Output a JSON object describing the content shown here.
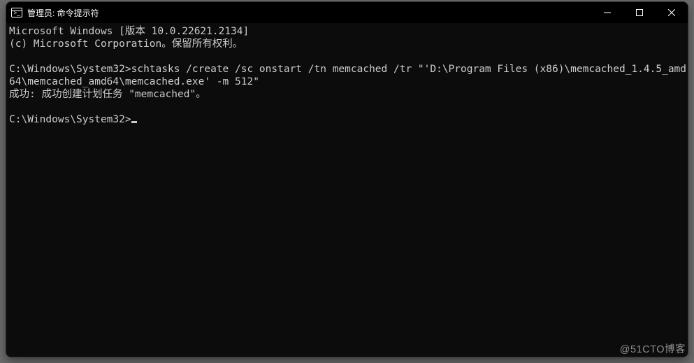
{
  "window": {
    "title": "管理员: 命令提示符"
  },
  "terminal": {
    "banner_line1": "Microsoft Windows [版本 10.0.22621.2134]",
    "banner_line2": "(c) Microsoft Corporation。保留所有权利。",
    "prompt1": "C:\\Windows\\System32>",
    "command": "schtasks /create /sc onstart /tn memcached /tr \"'D:\\Program Files (x86)\\memcached_1.4.5_amd64\\memcached_amd64\\memcached.exe' -m 512\"",
    "result": "成功: 成功创建计划任务 \"memcached\"。",
    "prompt2": "C:\\Windows\\System32>"
  },
  "watermark": "@51CTO博客"
}
